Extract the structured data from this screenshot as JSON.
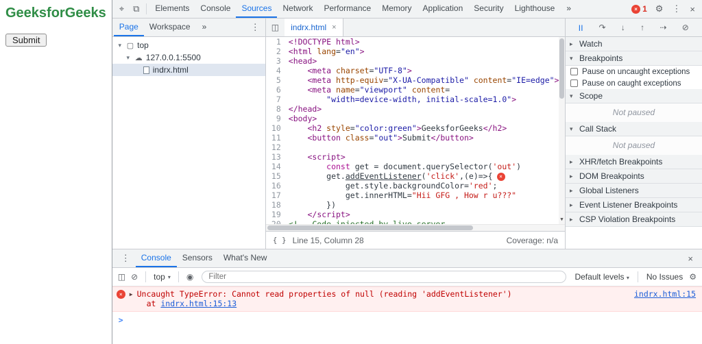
{
  "icons": {
    "inspect": "⌖",
    "device": "⧉",
    "gear": "⚙",
    "kebab": "⋮",
    "close": "×",
    "more": "»",
    "badge_x": "×",
    "panel": "◫",
    "tab_close": "×",
    "braces": "{ }",
    "clear": "⊘",
    "eye": "◉",
    "caret": "▾",
    "expand": "▶",
    "prompt": ">",
    "down_arrow": "▼"
  },
  "colors": {
    "accent": "#1a73e8",
    "gfg_green": "#2f8d46",
    "error_red": "#ea4335"
  },
  "page": {
    "title": "GeeksforGeeks",
    "submit_label": "Submit"
  },
  "devtools": {
    "main_tabs": [
      "Elements",
      "Console",
      "Sources",
      "Network",
      "Performance",
      "Memory",
      "Application",
      "Security",
      "Lighthouse"
    ],
    "active_main_tab": "Sources",
    "error_badge_count": "1"
  },
  "sources": {
    "nav_tabs": [
      "Page",
      "Workspace"
    ],
    "active_nav_tab": "Page",
    "tree": [
      {
        "label": "top",
        "icon": "frame",
        "depth": 0,
        "expanded": true
      },
      {
        "label": "127.0.0.1:5500",
        "icon": "cloud",
        "depth": 1,
        "expanded": true
      },
      {
        "label": "indrx.html",
        "icon": "file",
        "depth": 2,
        "selected": true
      }
    ],
    "editor_tab": "indrx.html",
    "status": {
      "line_col": "Line 15, Column 28",
      "coverage": "Coverage: n/a"
    },
    "code_lines": [
      {
        "n": 1,
        "tokens": [
          [
            "t",
            "<!DOCTYPE html>"
          ]
        ]
      },
      {
        "n": 2,
        "tokens": [
          [
            "t",
            "<html"
          ],
          [
            "a",
            " lang"
          ],
          [
            "p",
            "="
          ],
          [
            "v",
            "\"en\""
          ],
          [
            "t",
            ">"
          ]
        ]
      },
      {
        "n": 3,
        "tokens": [
          [
            "t",
            "<head>"
          ]
        ]
      },
      {
        "n": 4,
        "tokens": [
          [
            "p",
            "    "
          ],
          [
            "t",
            "<meta"
          ],
          [
            "a",
            " charset"
          ],
          [
            "p",
            "="
          ],
          [
            "v",
            "\"UTF-8\""
          ],
          [
            "t",
            ">"
          ]
        ]
      },
      {
        "n": 5,
        "tokens": [
          [
            "p",
            "    "
          ],
          [
            "t",
            "<meta"
          ],
          [
            "a",
            " http-equiv"
          ],
          [
            "p",
            "="
          ],
          [
            "v",
            "\"X-UA-Compatible\""
          ],
          [
            "a",
            " content"
          ],
          [
            "p",
            "="
          ],
          [
            "v",
            "\"IE=edge\""
          ],
          [
            "t",
            ">"
          ]
        ]
      },
      {
        "n": 6,
        "tokens": [
          [
            "p",
            "    "
          ],
          [
            "t",
            "<meta"
          ],
          [
            "a",
            " name"
          ],
          [
            "p",
            "="
          ],
          [
            "v",
            "\"viewport\""
          ],
          [
            "a",
            " content"
          ],
          [
            "p",
            "="
          ]
        ]
      },
      {
        "n": 7,
        "tokens": [
          [
            "p",
            "        "
          ],
          [
            "v",
            "\"width=device-width, initial-scale=1.0\""
          ],
          [
            "t",
            ">"
          ]
        ]
      },
      {
        "n": 8,
        "tokens": [
          [
            "t",
            "</head>"
          ]
        ]
      },
      {
        "n": 9,
        "tokens": [
          [
            "t",
            "<body>"
          ]
        ]
      },
      {
        "n": 10,
        "tokens": [
          [
            "p",
            "    "
          ],
          [
            "t",
            "<h2"
          ],
          [
            "a",
            " style"
          ],
          [
            "p",
            "="
          ],
          [
            "v",
            "\"color:green\""
          ],
          [
            "t",
            ">"
          ],
          [
            "p",
            "GeeksforGeeks"
          ],
          [
            "t",
            "</h2>"
          ]
        ]
      },
      {
        "n": 11,
        "tokens": [
          [
            "p",
            "    "
          ],
          [
            "t",
            "<button"
          ],
          [
            "a",
            " class"
          ],
          [
            "p",
            "="
          ],
          [
            "v",
            "\"out\""
          ],
          [
            "t",
            ">"
          ],
          [
            "p",
            "Submit"
          ],
          [
            "t",
            "</button>"
          ]
        ]
      },
      {
        "n": 12,
        "tokens": []
      },
      {
        "n": 13,
        "tokens": [
          [
            "p",
            "    "
          ],
          [
            "t",
            "<script>"
          ]
        ]
      },
      {
        "n": 14,
        "tokens": [
          [
            "p",
            "        "
          ],
          [
            "k",
            "const"
          ],
          [
            "p",
            " get = document.querySelector("
          ],
          [
            "s",
            "'out'"
          ],
          [
            "p",
            ")"
          ]
        ]
      },
      {
        "n": 15,
        "tokens": [
          [
            "p",
            "        get."
          ],
          [
            "u",
            "addEventListener"
          ],
          [
            "p",
            "("
          ],
          [
            "s",
            "'click'"
          ],
          [
            "p",
            ",(e)=>{"
          ]
        ],
        "error": true
      },
      {
        "n": 16,
        "tokens": [
          [
            "p",
            "            get.style.backgroundColor="
          ],
          [
            "s",
            "'red'"
          ],
          [
            "p",
            ";"
          ]
        ]
      },
      {
        "n": 17,
        "tokens": [
          [
            "p",
            "            get.innerHTML="
          ],
          [
            "s",
            "\"Hii GFG , How r u???\""
          ]
        ]
      },
      {
        "n": 18,
        "tokens": [
          [
            "p",
            "        })"
          ]
        ]
      },
      {
        "n": 19,
        "tokens": [
          [
            "p",
            "    "
          ],
          [
            "t",
            "</script>"
          ]
        ]
      },
      {
        "n": 20,
        "tokens": [
          [
            "c",
            "<!-- Code injected by live-server"
          ]
        ]
      }
    ]
  },
  "debugger": {
    "toolbar_icons": [
      {
        "name": "pause-icon",
        "glyph": "||",
        "blue": true
      },
      {
        "name": "step-over-icon",
        "glyph": "↷"
      },
      {
        "name": "step-into-icon",
        "glyph": "↓"
      },
      {
        "name": "step-out-icon",
        "glyph": "↑"
      },
      {
        "name": "step-icon",
        "glyph": "⇢"
      },
      {
        "name": "deactivate-breakpoints-icon",
        "glyph": "⊘"
      }
    ],
    "sections": [
      {
        "label": "Watch",
        "collapsed": true
      },
      {
        "label": "Breakpoints",
        "collapsed": false,
        "items": [
          "Pause on uncaught exceptions",
          "Pause on caught exceptions"
        ]
      },
      {
        "label": "Scope",
        "collapsed": false,
        "placeholder": "Not paused"
      },
      {
        "label": "Call Stack",
        "collapsed": false,
        "placeholder": "Not paused"
      },
      {
        "label": "XHR/fetch Breakpoints",
        "collapsed": true
      },
      {
        "label": "DOM Breakpoints",
        "collapsed": true
      },
      {
        "label": "Global Listeners",
        "collapsed": true
      },
      {
        "label": "Event Listener Breakpoints",
        "collapsed": true
      },
      {
        "label": "CSP Violation Breakpoints",
        "collapsed": true
      }
    ]
  },
  "console": {
    "tabs": [
      "Console",
      "Sensors",
      "What's New"
    ],
    "active_tab": "Console",
    "context": "top",
    "filter_placeholder": "Filter",
    "levels_label": "Default levels",
    "issues_label": "No Issues",
    "error": {
      "message": "Uncaught TypeError: Cannot read properties of null (reading 'addEventListener')",
      "at_label": "at ",
      "stack_link": "indrx.html:15:13",
      "source_link": "indrx.html:15"
    }
  }
}
